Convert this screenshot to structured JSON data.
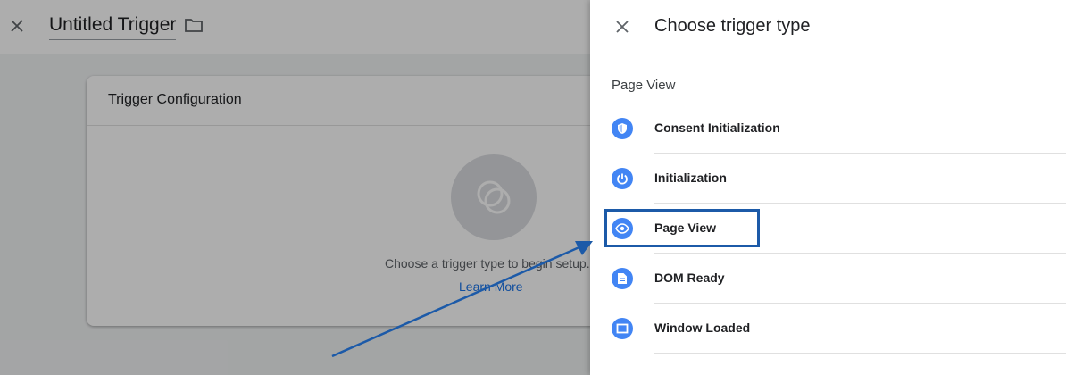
{
  "editor": {
    "title": "Untitled Trigger",
    "close_icon": "close-icon",
    "folder_icon": "folder-icon"
  },
  "card": {
    "title": "Trigger Configuration",
    "hint": "Choose a trigger type to begin setup...",
    "link": "Learn More"
  },
  "panel": {
    "title": "Choose trigger type",
    "section": "Page View",
    "items": [
      {
        "label": "Consent Initialization",
        "icon": "shield-icon"
      },
      {
        "label": "Initialization",
        "icon": "power-icon"
      },
      {
        "label": "Page View",
        "icon": "eye-icon"
      },
      {
        "label": "DOM Ready",
        "icon": "document-icon"
      },
      {
        "label": "Window Loaded",
        "icon": "window-icon"
      }
    ]
  },
  "colors": {
    "accent": "#4285f4",
    "annotation": "#1c5aa8"
  }
}
